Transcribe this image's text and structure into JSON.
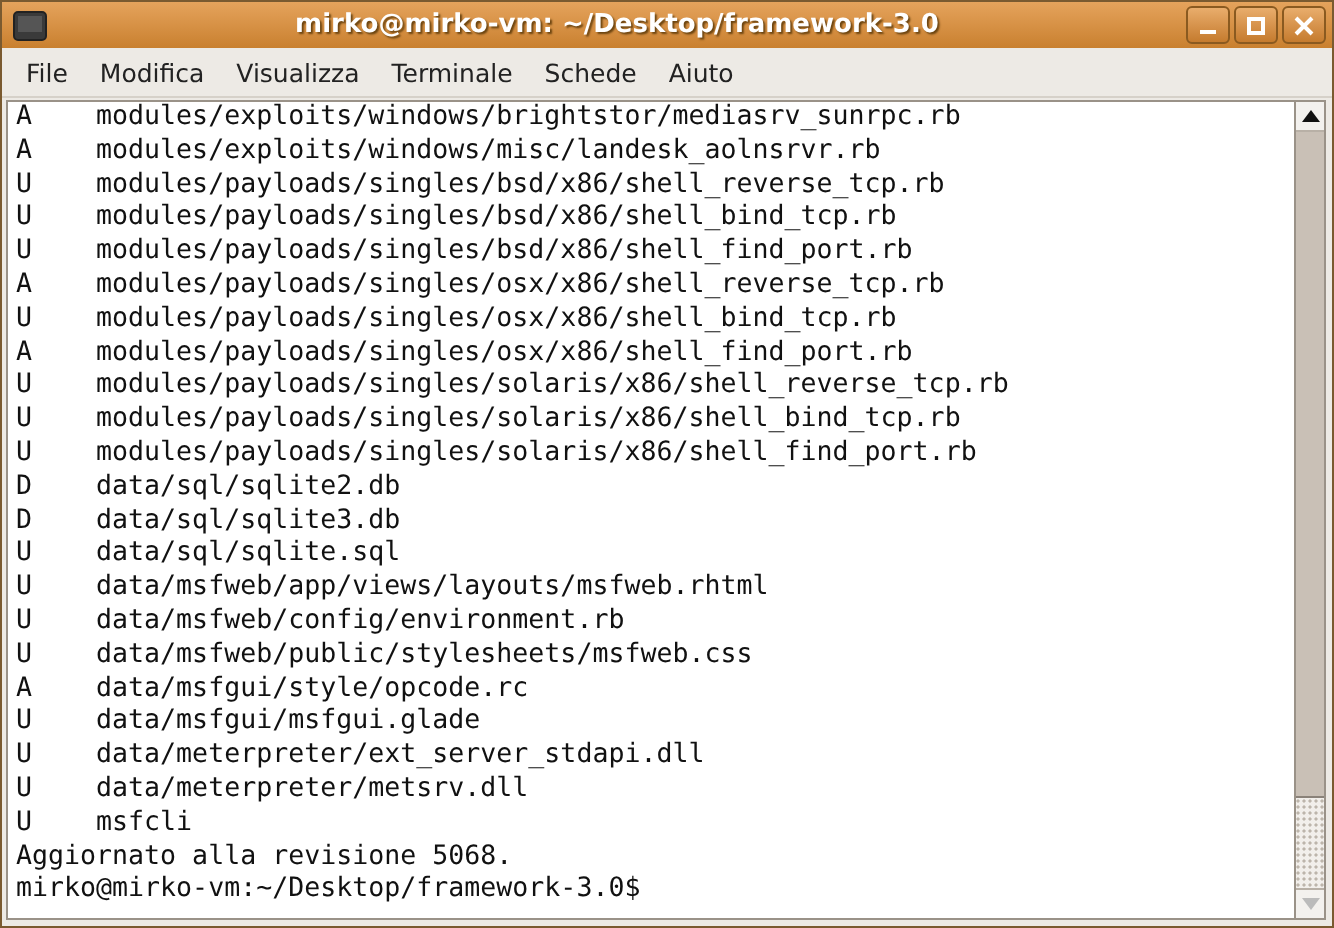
{
  "window": {
    "title": "mirko@mirko-vm: ~/Desktop/framework-3.0"
  },
  "menu": [
    "File",
    "Modifica",
    "Visualizza",
    "Terminale",
    "Schede",
    "Aiuto"
  ],
  "terminal": {
    "lines": [
      "A    modules/exploits/windows/brightstor/mediasrv_sunrpc.rb",
      "A    modules/exploits/windows/misc/landesk_aolnsrvr.rb",
      "U    modules/payloads/singles/bsd/x86/shell_reverse_tcp.rb",
      "U    modules/payloads/singles/bsd/x86/shell_bind_tcp.rb",
      "U    modules/payloads/singles/bsd/x86/shell_find_port.rb",
      "A    modules/payloads/singles/osx/x86/shell_reverse_tcp.rb",
      "U    modules/payloads/singles/osx/x86/shell_bind_tcp.rb",
      "A    modules/payloads/singles/osx/x86/shell_find_port.rb",
      "U    modules/payloads/singles/solaris/x86/shell_reverse_tcp.rb",
      "U    modules/payloads/singles/solaris/x86/shell_bind_tcp.rb",
      "U    modules/payloads/singles/solaris/x86/shell_find_port.rb",
      "D    data/sql/sqlite2.db",
      "D    data/sql/sqlite3.db",
      "U    data/sql/sqlite.sql",
      "U    data/msfweb/app/views/layouts/msfweb.rhtml",
      "U    data/msfweb/config/environment.rb",
      "U    data/msfweb/public/stylesheets/msfweb.css",
      "A    data/msfgui/style/opcode.rc",
      "U    data/msfgui/msfgui.glade",
      "U    data/meterpreter/ext_server_stdapi.dll",
      "U    data/meterpreter/metsrv.dll",
      "U    msfcli",
      "Aggiornato alla revisione 5068.",
      "mirko@mirko-vm:~/Desktop/framework-3.0$"
    ]
  }
}
